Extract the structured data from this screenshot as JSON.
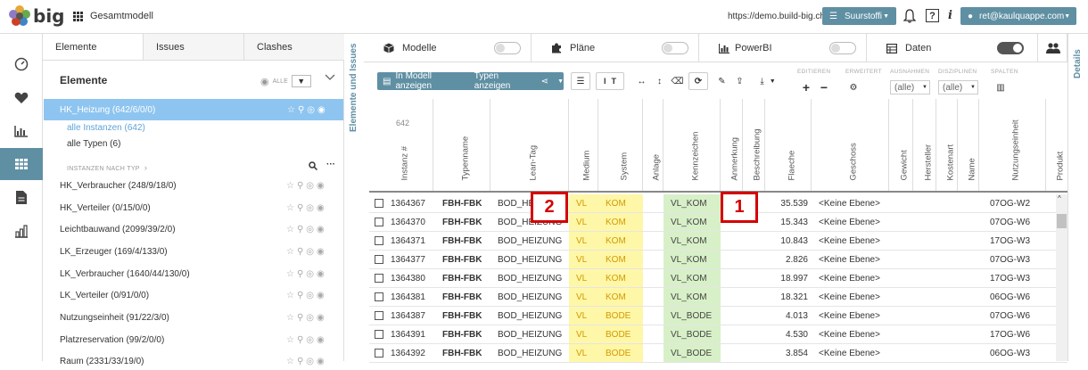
{
  "header": {
    "logo_text": "big",
    "project": "Gesamtmodell",
    "url": "https://demo.build-big.ch",
    "project_selector": "Suurstoffi",
    "user": "ret@kaulquappe.com",
    "help_label": "?",
    "info_label": "i"
  },
  "panel": {
    "tabs": [
      "Elemente",
      "Issues",
      "Clashes"
    ],
    "title": "Elemente",
    "filter_label": "ALLE",
    "selected": "HK_Heizung (642/6/0/0)",
    "sub_links": [
      "alle Instanzen (642)",
      "alle Typen (6)"
    ],
    "section_label": "INSTANZEN NACH TYP",
    "types": [
      "HK_Verbraucher (248/9/18/0)",
      "HK_Verteiler (0/15/0/0)",
      "Leichtbauwand (2099/39/2/0)",
      "LK_Erzeuger (169/4/133/0)",
      "LK_Verbraucher (1640/44/130/0)",
      "LK_Verteiler (0/91/0/0)",
      "Nutzungseinheit (91/22/3/0)",
      "Platzreservation (99/2/0/0)",
      "Raum (2331/33/19/0)"
    ]
  },
  "side_labels": {
    "left": "Elemente und Issues",
    "right": "Details"
  },
  "modules": [
    {
      "label": "Modelle",
      "on": false
    },
    {
      "label": "Pläne",
      "on": false
    },
    {
      "label": "PowerBI",
      "on": false
    },
    {
      "label": "Daten",
      "on": true
    }
  ],
  "toolbar": {
    "show_in_model": "In Modell anzeigen",
    "show_types": "Typen anzeigen",
    "groups": {
      "edit": "EDITIEREN",
      "extended": "ERWEITERT",
      "exceptions": "AUSNAHMEN",
      "disciplines": "DISZIPLINEN",
      "columns": "SPALTEN"
    },
    "exceptions_value": "(alle)",
    "disciplines_value": "(alle)"
  },
  "table": {
    "count": "642",
    "columns": [
      "Instanz #",
      "Typenname",
      "Lean-Tag",
      "Medium",
      "System",
      "Anlage",
      "Kennzeichen",
      "Anmerkung",
      "Beschreibung",
      "Flaeche",
      "Geschoss",
      "Gewicht",
      "Hersteller",
      "Kostenart",
      "Name",
      "Nutzungseinheit",
      "Produkt"
    ],
    "rows": [
      {
        "id": "1364367",
        "type": "FBH-FBK",
        "lean": "BOD_HEIZUNG",
        "medium": "VL",
        "system": "KOM",
        "kenn": "VL_KOM",
        "flaeche": "35.539",
        "geschoss": "<Keine Ebene>",
        "nutzung": "07OG-W2"
      },
      {
        "id": "1364370",
        "type": "FBH-FBK",
        "lean": "BOD_HEIZUNG",
        "medium": "VL",
        "system": "KOM",
        "kenn": "VL_KOM",
        "flaeche": "15.343",
        "geschoss": "<Keine Ebene>",
        "nutzung": "07OG-W6"
      },
      {
        "id": "1364371",
        "type": "FBH-FBK",
        "lean": "BOD_HEIZUNG",
        "medium": "VL",
        "system": "KOM",
        "kenn": "VL_KOM",
        "flaeche": "10.843",
        "geschoss": "<Keine Ebene>",
        "nutzung": "17OG-W3"
      },
      {
        "id": "1364377",
        "type": "FBH-FBK",
        "lean": "BOD_HEIZUNG",
        "medium": "VL",
        "system": "KOM",
        "kenn": "VL_KOM",
        "flaeche": "2.826",
        "geschoss": "<Keine Ebene>",
        "nutzung": "07OG-W3"
      },
      {
        "id": "1364380",
        "type": "FBH-FBK",
        "lean": "BOD_HEIZUNG",
        "medium": "VL",
        "system": "KOM",
        "kenn": "VL_KOM",
        "flaeche": "18.997",
        "geschoss": "<Keine Ebene>",
        "nutzung": "17OG-W3"
      },
      {
        "id": "1364381",
        "type": "FBH-FBK",
        "lean": "BOD_HEIZUNG",
        "medium": "VL",
        "system": "KOM",
        "kenn": "VL_KOM",
        "flaeche": "18.321",
        "geschoss": "<Keine Ebene>",
        "nutzung": "06OG-W6"
      },
      {
        "id": "1364387",
        "type": "FBH-FBK",
        "lean": "BOD_HEIZUNG",
        "medium": "VL",
        "system": "BODE",
        "kenn": "VL_BODE",
        "flaeche": "4.013",
        "geschoss": "<Keine Ebene>",
        "nutzung": "07OG-W6"
      },
      {
        "id": "1364391",
        "type": "FBH-FBK",
        "lean": "BOD_HEIZUNG",
        "medium": "VL",
        "system": "BODE",
        "kenn": "VL_BODE",
        "flaeche": "4.530",
        "geschoss": "<Keine Ebene>",
        "nutzung": "17OG-W6"
      },
      {
        "id": "1364392",
        "type": "FBH-FBK",
        "lean": "BOD_HEIZUNG",
        "medium": "VL",
        "system": "BODE",
        "kenn": "VL_BODE",
        "flaeche": "3.854",
        "geschoss": "<Keine Ebene>",
        "nutzung": "06OG-W3"
      }
    ]
  },
  "markers": [
    "1",
    "2"
  ]
}
